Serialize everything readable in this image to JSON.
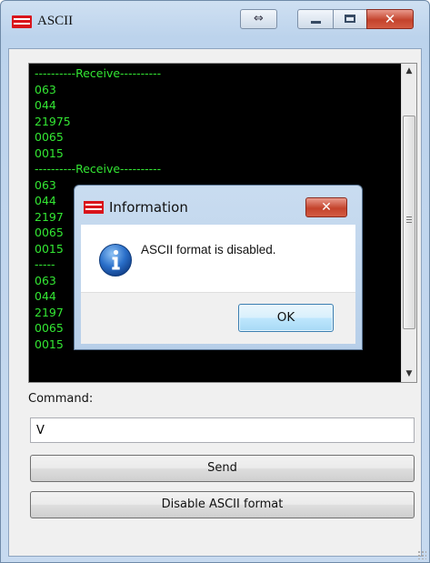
{
  "window": {
    "title": "ASCII",
    "swap_glyph": "⇔",
    "close_glyph": "✕"
  },
  "console": {
    "lines": [
      "----------Receive----------",
      "063",
      "044",
      "21975",
      "0065",
      "0015",
      "----------Receive----------",
      "063",
      "044",
      "2197",
      "0065",
      "0015",
      "-----",
      "063",
      "044",
      "2197",
      "0065",
      "0015"
    ],
    "text_color": "#33e633",
    "scroll_up_glyph": "▲",
    "scroll_down_glyph": "▼"
  },
  "command": {
    "label": "Command:",
    "value": "V"
  },
  "buttons": {
    "send": "Send",
    "disable_ascii": "Disable ASCII format"
  },
  "dialog": {
    "title": "Information",
    "message": "ASCII format is disabled.",
    "ok_label": "OK",
    "close_glyph": "✕",
    "icon": "info-icon"
  },
  "colors": {
    "close_red": "#c4432c",
    "console_bg": "#000000",
    "logo_red": "#d9141b"
  }
}
